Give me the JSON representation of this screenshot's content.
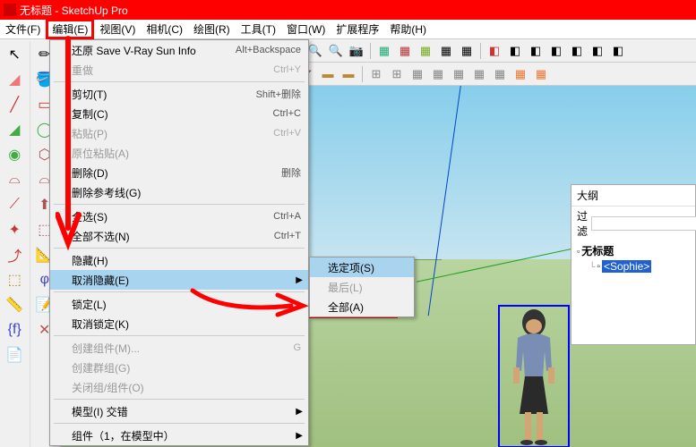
{
  "app": {
    "title": "无标题 - SketchUp Pro",
    "icon": "sketchup"
  },
  "menubar": {
    "items": [
      {
        "label": "文件(F)"
      },
      {
        "label": "编辑(E)",
        "highlighted": true
      },
      {
        "label": "视图(V)"
      },
      {
        "label": "相机(C)"
      },
      {
        "label": "绘图(R)"
      },
      {
        "label": "工具(T)"
      },
      {
        "label": "窗口(W)"
      },
      {
        "label": "扩展程序"
      },
      {
        "label": "帮助(H)"
      }
    ]
  },
  "edit_menu": {
    "items": [
      {
        "label": "还原 Save V-Ray Sun Info",
        "shortcut": "Alt+Backspace"
      },
      {
        "label": "重做",
        "shortcut": "Ctrl+Y",
        "disabled": true
      },
      {
        "sep": true
      },
      {
        "label": "剪切(T)",
        "shortcut": "Shift+删除"
      },
      {
        "label": "复制(C)",
        "shortcut": "Ctrl+C"
      },
      {
        "label": "粘贴(P)",
        "shortcut": "Ctrl+V",
        "disabled": true
      },
      {
        "label": "原位粘贴(A)",
        "disabled": true
      },
      {
        "label": "删除(D)",
        "shortcut": "删除"
      },
      {
        "label": "删除参考线(G)"
      },
      {
        "sep": true
      },
      {
        "label": "全选(S)",
        "shortcut": "Ctrl+A"
      },
      {
        "label": "全部不选(N)",
        "shortcut": "Ctrl+T"
      },
      {
        "sep": true
      },
      {
        "label": "隐藏(H)"
      },
      {
        "label": "取消隐藏(E)",
        "submenu": true,
        "hover": true
      },
      {
        "sep": true
      },
      {
        "label": "锁定(L)"
      },
      {
        "label": "取消锁定(K)"
      },
      {
        "sep": true
      },
      {
        "label": "创建组件(M)...",
        "shortcut": "G",
        "disabled": true
      },
      {
        "label": "创建群组(G)",
        "disabled": true
      },
      {
        "label": "关闭组/组件(O)",
        "disabled": true
      },
      {
        "sep": true
      },
      {
        "label": "模型(I) 交错",
        "submenu": true
      },
      {
        "sep": true
      },
      {
        "label": "组件（1，在模型中）",
        "submenu": true
      }
    ]
  },
  "unhide_submenu": {
    "items": [
      {
        "label": "选定项(S)",
        "hover": true
      },
      {
        "label": "最后(L)",
        "disabled": true
      },
      {
        "label": "全部(A)"
      }
    ]
  },
  "outliner": {
    "title": "大纲",
    "filter_label": "过滤",
    "filter_value": "",
    "root": "无标题",
    "items": [
      {
        "icon": "▫",
        "label": "<Sophie>",
        "selected": true
      }
    ]
  },
  "toolbar_icons_1": [
    "↖",
    "⬚",
    "⟲",
    "↷",
    "✂",
    "📋",
    "📄",
    "🗑",
    "🔒",
    "🔓",
    "🛈",
    "👁",
    "👁",
    "🔍",
    "🔍",
    "🔍",
    "📷",
    "🖼",
    "🔲",
    "🔲",
    "🔲",
    "🔲",
    "🔲",
    "🔲",
    "🔲",
    "🔲",
    "🔲"
  ],
  "toolbar_icons_2": [
    "⬚",
    "⬚",
    "◐",
    "✕",
    "⬚",
    "⬚",
    "⬚",
    "⊞",
    "⊡",
    "⬚",
    "◢",
    "◣",
    "◤",
    "📦",
    "📦",
    "⬚",
    "⬚",
    "⬚",
    "⬚",
    "⬚",
    "⬚",
    "⬚",
    "⬚",
    "⬚"
  ],
  "left_col1": [
    "↖",
    "🧹",
    "✏",
    "◢",
    "⊙",
    "⌒",
    "⟋",
    "✦",
    "⤴",
    "⬚",
    "📏",
    "{f}",
    "📄"
  ],
  "left_col2": [
    "✏",
    "🪣",
    "▭",
    "◯",
    "⊙",
    "⌓",
    "⟋",
    "⬡",
    "📐",
    "φ",
    "📝",
    "✕"
  ],
  "colors": {
    "accent_red": "#ff0000",
    "selection_blue": "#a8d4f0",
    "bbox_blue": "#0000ff"
  }
}
